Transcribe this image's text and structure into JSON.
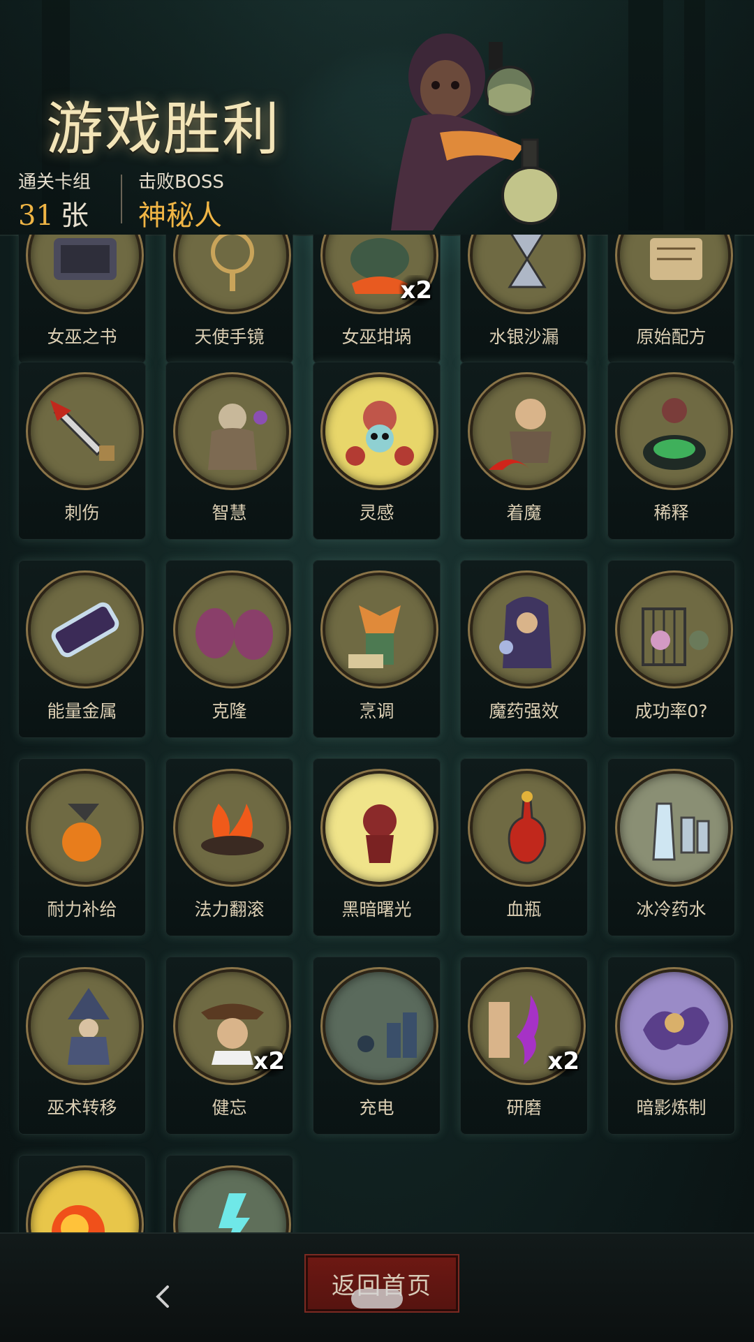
{
  "header": {
    "title": "游戏胜利",
    "stats": [
      {
        "label": "通关卡组",
        "value": "31",
        "unit": "张"
      },
      {
        "label": "击败BOSS",
        "value": "神秘人"
      }
    ]
  },
  "cards": [
    {
      "name": "女巫之书",
      "icon": "book-icon",
      "count": ""
    },
    {
      "name": "天使手镜",
      "icon": "mirror-icon",
      "count": ""
    },
    {
      "name": "女巫坩埚",
      "icon": "cauldron-icon",
      "count": "x2"
    },
    {
      "name": "水银沙漏",
      "icon": "hourglass-icon",
      "count": ""
    },
    {
      "name": "原始配方",
      "icon": "scroll-icon",
      "count": ""
    },
    {
      "name": "刺伤",
      "icon": "dagger-icon",
      "count": ""
    },
    {
      "name": "智慧",
      "icon": "sage-icon",
      "count": ""
    },
    {
      "name": "灵感",
      "icon": "skull-brain-icon",
      "count": ""
    },
    {
      "name": "着魔",
      "icon": "possessed-icon",
      "count": ""
    },
    {
      "name": "稀释",
      "icon": "witch-pot-icon",
      "count": ""
    },
    {
      "name": "能量金属",
      "icon": "battery-icon",
      "count": ""
    },
    {
      "name": "克隆",
      "icon": "eggs-icon",
      "count": ""
    },
    {
      "name": "烹调",
      "icon": "fox-cook-icon",
      "count": ""
    },
    {
      "name": "魔药强效",
      "icon": "hooded-mage-icon",
      "count": ""
    },
    {
      "name": "成功率0?",
      "icon": "cage-icon",
      "count": ""
    },
    {
      "name": "耐力补给",
      "icon": "potion-bird-icon",
      "count": ""
    },
    {
      "name": "法力翻滚",
      "icon": "fire-bowl-icon",
      "count": ""
    },
    {
      "name": "黑暗曙光",
      "icon": "demon-icon",
      "count": ""
    },
    {
      "name": "血瓶",
      "icon": "blood-bottle-icon",
      "count": ""
    },
    {
      "name": "冰冷药水",
      "icon": "ice-bottles-icon",
      "count": ""
    },
    {
      "name": "巫术转移",
      "icon": "wizard-icon",
      "count": ""
    },
    {
      "name": "健忘",
      "icon": "dizzy-pirate-icon",
      "count": "x2"
    },
    {
      "name": "充电",
      "icon": "city-storm-icon",
      "count": ""
    },
    {
      "name": "研磨",
      "icon": "grinder-icon",
      "count": "x2"
    },
    {
      "name": "暗影炼制",
      "icon": "shadow-smoke-icon",
      "count": ""
    },
    {
      "name": "",
      "icon": "fireball-icon",
      "count": ""
    },
    {
      "name": "",
      "icon": "lightning-icon",
      "count": ""
    }
  ],
  "footer": {
    "home_label": "返回首页",
    "back_icon": "chevron-left-icon",
    "nav_pill_icon": "home-pill-icon"
  },
  "colors": {
    "accent": "#f0b545",
    "button_red": "#6d1813",
    "medal_bg": "#6f6a43"
  }
}
